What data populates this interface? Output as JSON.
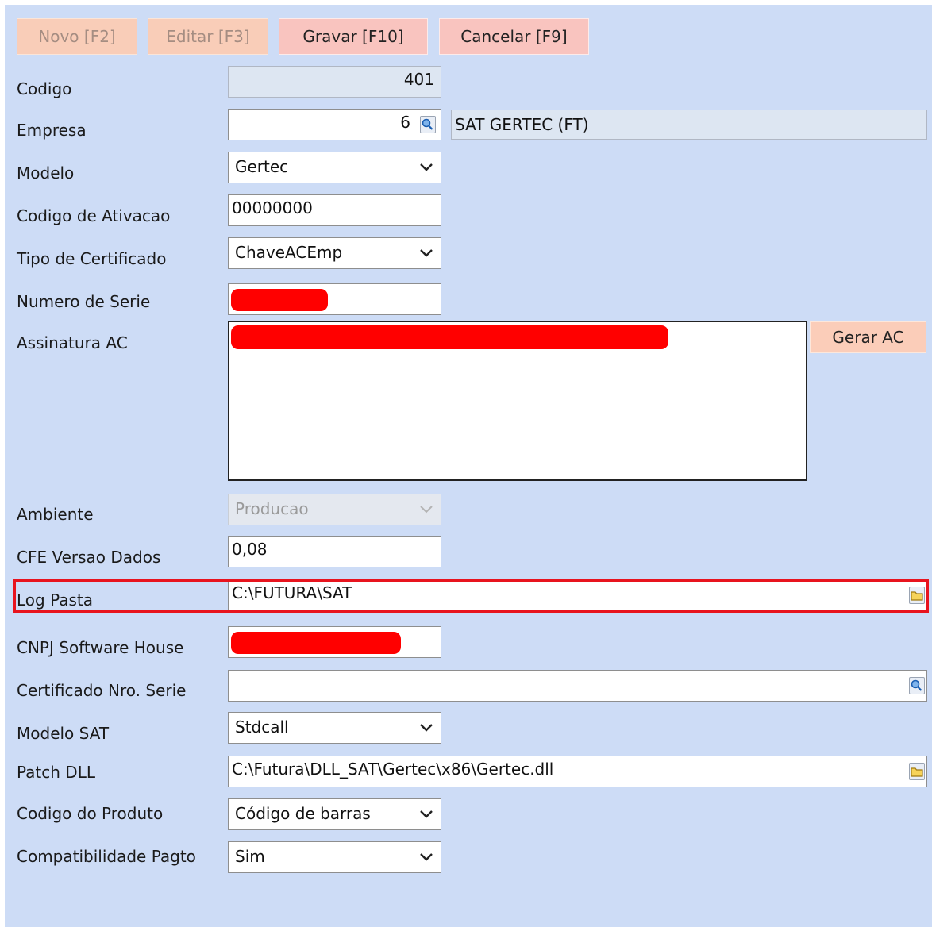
{
  "toolbar": {
    "novo": "Novo [F2]",
    "editar": "Editar [F3]",
    "gravar": "Gravar [F10]",
    "cancelar": "Cancelar [F9]"
  },
  "form": {
    "codigo": {
      "label": "Codigo",
      "value": "401"
    },
    "empresa": {
      "label": "Empresa",
      "value": "6",
      "name": "SAT GERTEC (FT)"
    },
    "modelo": {
      "label": "Modelo",
      "value": "Gertec"
    },
    "codigo_ativacao": {
      "label": "Codigo de Ativacao",
      "value": "00000000"
    },
    "tipo_certificado": {
      "label": "Tipo de Certificado",
      "value": "ChaveACEmp"
    },
    "numero_serie": {
      "label": "Numero de Serie"
    },
    "assinatura_ac": {
      "label": "Assinatura AC",
      "button": "Gerar AC"
    },
    "ambiente": {
      "label": "Ambiente",
      "value": "Producao"
    },
    "cfe_versao": {
      "label": "CFE Versao Dados",
      "value": "0,08"
    },
    "log_pasta": {
      "label": "Log Pasta",
      "value": "C:\\FUTURA\\SAT"
    },
    "cnpj_sh": {
      "label": "CNPJ Software House"
    },
    "certificado_serie": {
      "label": "Certificado Nro. Serie",
      "value": ""
    },
    "modelo_sat": {
      "label": "Modelo SAT",
      "value": "Stdcall"
    },
    "patch_dll": {
      "label": "Patch DLL",
      "value": "C:\\Futura\\DLL_SAT\\Gertec\\x86\\Gertec.dll"
    },
    "codigo_produto": {
      "label": "Codigo do Produto",
      "value": "Código de barras"
    },
    "compat_pagto": {
      "label": "Compatibilidade Pagto",
      "value": "Sim"
    }
  },
  "colors": {
    "panel": "#cddcf6",
    "highlight": "#e8141e",
    "redaction": "#ff0000"
  },
  "icons": {
    "lookup": "magnifier-icon",
    "folder": "folder-icon",
    "dropdown": "chevron-down-icon"
  }
}
